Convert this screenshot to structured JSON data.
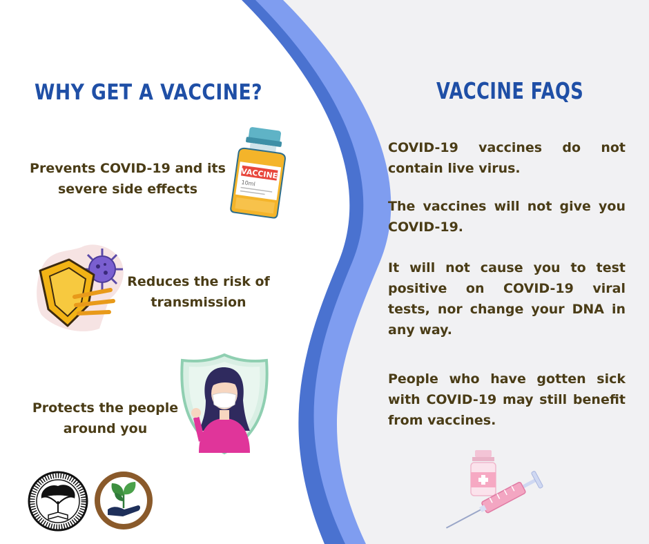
{
  "left_panel": {
    "title": "WHY GET A VACCINE?",
    "benefits": [
      {
        "text": "Prevents COVID-19 and its severe side effects",
        "icon": "vaccine-vial-icon"
      },
      {
        "text": "Reduces the risk of transmission",
        "icon": "shield-virus-icon"
      },
      {
        "text": "Protects the people around you",
        "icon": "woman-mask-shield-icon"
      }
    ],
    "vial_label": "VACCINE",
    "vial_volume": "10ml",
    "logos": [
      {
        "name": "university-of-san-carlos-seal",
        "text": "UNIVERSITY OF SAN CARLOS · JUNIOR PHILIPPINE INSTITUTE OF ACCOUNTANTS"
      },
      {
        "name": "plant-hand-logo"
      }
    ]
  },
  "right_panel": {
    "title": "VACCINE FAQS",
    "facts": [
      "COVID-19 vaccines do not contain live virus.",
      "The vaccines will not give you COVID-19.",
      "It will not cause you to test positive on COVID-19 viral tests, nor change your DNA in any way.",
      "People who have gotten sick with COVID-19 may still benefit from vaccines."
    ],
    "illustration": "syringe-and-vial-icon"
  },
  "colors": {
    "heading": "#1f4fa6",
    "body_text": "#4a3c16",
    "wave_dark": "#3a5fbf",
    "wave_light": "#6f90ea",
    "right_background": "#f1f1f3"
  }
}
